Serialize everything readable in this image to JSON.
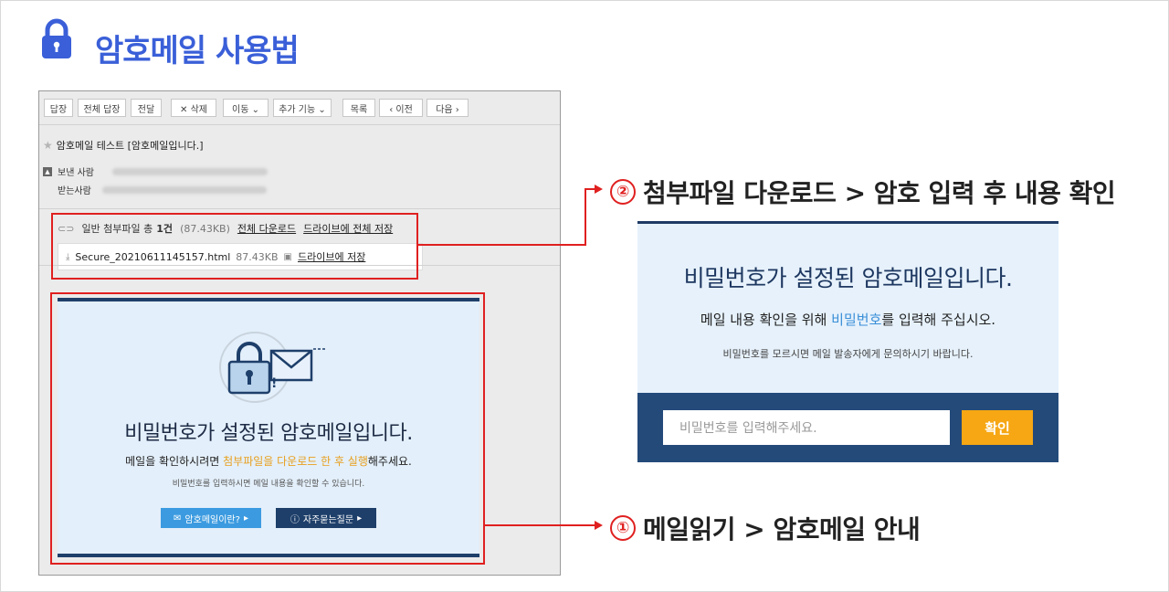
{
  "page": {
    "title": "암호메일 사용법"
  },
  "toolbar": {
    "reply": "답장",
    "reply_all": "전체 답장",
    "forward": "전달",
    "delete": "✕ 삭제",
    "move": "이동 ⌄",
    "more": "추가 기능 ⌄",
    "list": "목록",
    "prev": "‹ 이전",
    "next": "다음 ›"
  },
  "mail": {
    "subject": "암호메일 테스트 [암호메일입니다.]",
    "from_label": "보낸 사람",
    "to_label": "받는사람",
    "attach_summary_prefix": "일반 첨부파일 총",
    "attach_count": "1건",
    "attach_total_size": "(87.43KB)",
    "download_all": "전체 다운로드",
    "save_all_drive": "드라이브에 전체 저장",
    "file_name": "Secure_20210611145157.html",
    "file_size": "87.43KB",
    "save_drive": "드라이브에 저장"
  },
  "notice": {
    "title": "비밀번호가 설정된 암호메일입니다.",
    "sub_before": "메일을 확인하시려면 ",
    "sub_highlight": "첨부파일을 다운로드 한 후 실행",
    "sub_after": "해주세요.",
    "small": "비밀번호를 입력하시면 메일 내용을 확인할 수 있습니다.",
    "btn_what": "암호메일이란?",
    "btn_faq": "자주묻는질문"
  },
  "callouts": {
    "step2_num": "②",
    "step2": "첨부파일 다운로드 > 암호 입력 후 내용 확인",
    "step1_num": "①",
    "step1": "메일읽기 > 암호메일 안내"
  },
  "password_panel": {
    "title": "비밀번호가 설정된 암호메일입니다.",
    "sub_before": "메일 내용 확인을 위해 ",
    "sub_highlight": "비밀번호",
    "sub_after": "를 입력해 주십시오.",
    "small": "비밀번호를 모르시면 메일 발송자에게 문의하시기 바랍니다.",
    "input_placeholder": "비밀번호를 입력해주세요.",
    "confirm": "확인"
  },
  "colors": {
    "title_blue": "#3a5fd8",
    "highlight_red": "#e02020",
    "navy": "#1e3f6a",
    "orange": "#f6a713"
  }
}
